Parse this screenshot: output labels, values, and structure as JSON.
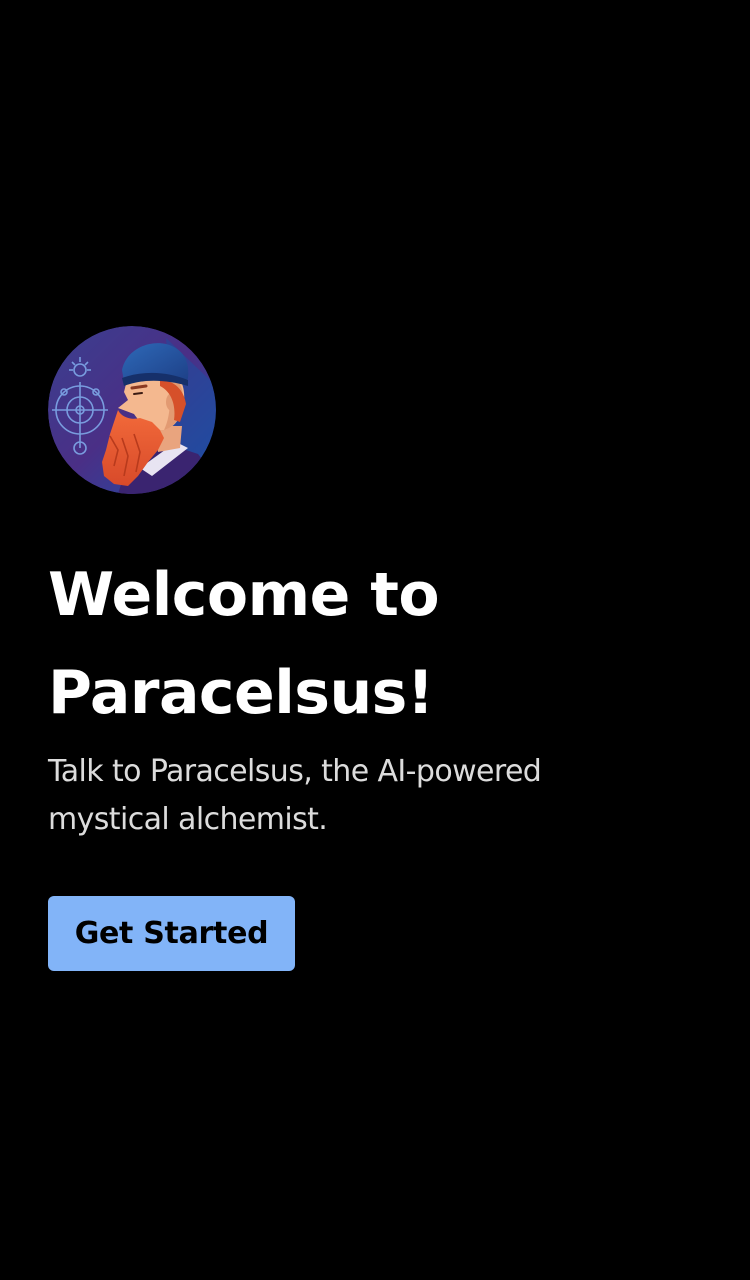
{
  "welcome": {
    "title_line1": "Welcome to",
    "title_line2": "Paracelsus!",
    "subtitle": "Talk to Paracelsus, the AI-powered mystical alchemist.",
    "cta_label": "Get Started"
  },
  "avatar": {
    "icon": "paracelsus-portrait-icon"
  },
  "colors": {
    "background": "#000000",
    "title": "#ffffff",
    "subtitle": "#dcdcdc",
    "button_bg": "#82b4f8",
    "button_text": "#000000"
  }
}
